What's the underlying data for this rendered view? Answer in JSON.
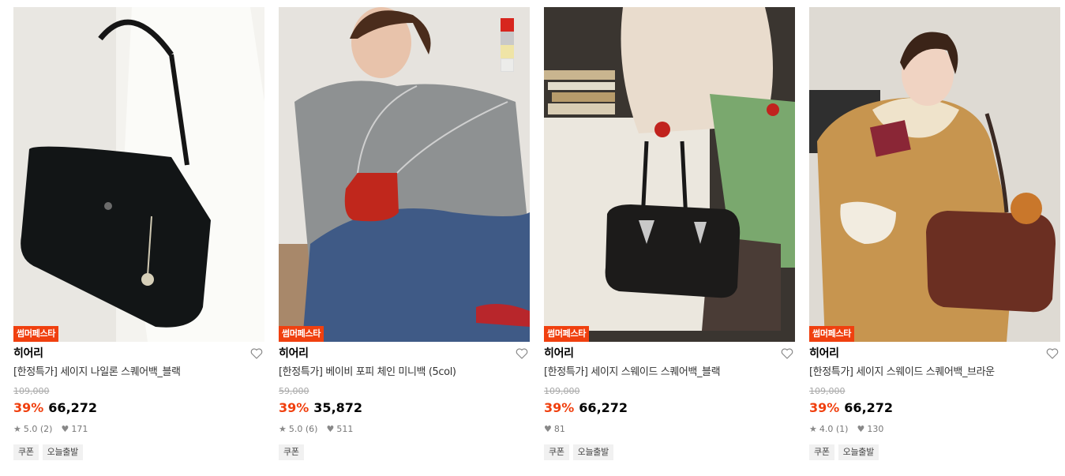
{
  "products": [
    {
      "badge": "썸머페스타",
      "brand": "히어리",
      "title": "[한정특가] 세이지 나일론 스퀘어백_블랙",
      "original_price": "109,000",
      "discount": "39%",
      "price": "66,272",
      "rating": "5.0 (2)",
      "likes": "171",
      "tags": [
        "쿠폰",
        "오늘출발"
      ],
      "bag_color": "#121516",
      "bg_color": "#e9e7e2"
    },
    {
      "badge": "썸머페스타",
      "brand": "히어리",
      "title": "[한정특가] 베이비 포피 체인 미니백 (5col)",
      "original_price": "59,000",
      "discount": "39%",
      "price": "35,872",
      "rating": "5.0 (6)",
      "likes": "511",
      "tags": [
        "쿠폰"
      ],
      "bag_color": "#c0271c",
      "bg_color": "#e6e3de",
      "swatches": [
        "#d7261e",
        "#c9c9c9",
        "#efe4a6",
        "#ececea"
      ]
    },
    {
      "badge": "썸머페스타",
      "brand": "히어리",
      "title": "[한정특가] 세이지 스웨이드 스퀘어백_블랙",
      "original_price": "109,000",
      "discount": "39%",
      "price": "66,272",
      "rating": "",
      "likes": "81",
      "tags": [
        "쿠폰",
        "오늘출발"
      ],
      "bag_color": "#1c1b1a",
      "bg_color": "#3a3530"
    },
    {
      "badge": "썸머페스타",
      "brand": "히어리",
      "title": "[한정특가] 세이지 스웨이드 스퀘어백_브라운",
      "original_price": "109,000",
      "discount": "39%",
      "price": "66,272",
      "rating": "4.0 (1)",
      "likes": "130",
      "tags": [
        "쿠폰",
        "오늘출발"
      ],
      "bag_color": "#6b2f22",
      "bg_color": "#dedad3"
    }
  ]
}
